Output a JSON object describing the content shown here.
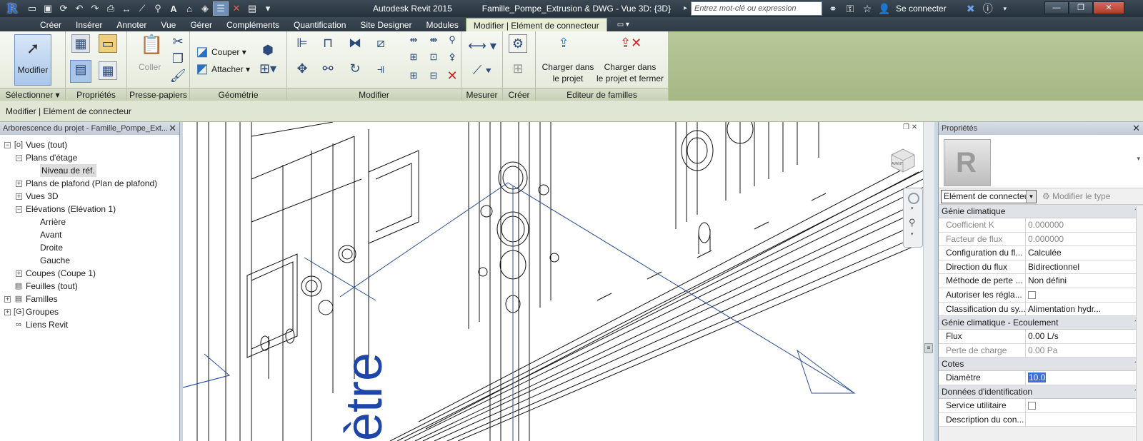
{
  "app": {
    "logo_letter": "R",
    "title": "Autodesk Revit 2015",
    "document": "Famille_Pompe_Extrusion & DWG - Vue 3D: {3D}",
    "search_placeholder": "Entrez mot-clé ou expression",
    "signin": "Se connecter"
  },
  "tabs": [
    "Créer",
    "Insérer",
    "Annoter",
    "Vue",
    "Gérer",
    "Compléments",
    "Quantification",
    "Site Designer",
    "Modules",
    "Modifier | Elément de connecteur"
  ],
  "ribbon": {
    "panels": {
      "select": "Sélectionner",
      "properties": "Propriétés",
      "clipboard": "Presse-papiers",
      "geometry": "Géométrie",
      "modify": "Modifier",
      "measure": "Mesurer",
      "create": "Créer",
      "family_editor": "Editeur de familles"
    },
    "modify_button": "Modifier",
    "paste": "Coller",
    "cut": "Couper",
    "join": "Attacher",
    "load_project_1": "Charger dans",
    "load_project_2": "le projet",
    "load_close_1": "Charger dans",
    "load_close_2": "le projet et fermer"
  },
  "options_bar": "Modifier | Elément de connecteur",
  "browser": {
    "title": "Arborescence du projet - Famille_Pompe_Ext...",
    "nodes": [
      {
        "label": "Vues (tout)",
        "level": 0,
        "pm": "−",
        "icon": "[o]"
      },
      {
        "label": "Plans d'étage",
        "level": 1,
        "pm": "−"
      },
      {
        "label": "Niveau de réf.",
        "level": 2,
        "selected": true
      },
      {
        "label": "Plans de plafond (Plan de plafond)",
        "level": 1,
        "pm": "+"
      },
      {
        "label": "Vues 3D",
        "level": 1,
        "pm": "+"
      },
      {
        "label": "Elévations (Elévation 1)",
        "level": 1,
        "pm": "−"
      },
      {
        "label": "Arrière",
        "level": 2
      },
      {
        "label": "Avant",
        "level": 2
      },
      {
        "label": "Droite",
        "level": 2
      },
      {
        "label": "Gauche",
        "level": 2
      },
      {
        "label": "Coupes (Coupe 1)",
        "level": 1,
        "pm": "+"
      },
      {
        "label": "Feuilles (tout)",
        "level": 0,
        "pm": "",
        "icon": "▤"
      },
      {
        "label": "Familles",
        "level": 0,
        "pm": "+",
        "icon": "▤"
      },
      {
        "label": "Groupes",
        "level": 0,
        "pm": "+",
        "icon": "[G]"
      },
      {
        "label": "Liens Revit",
        "level": 0,
        "pm": "",
        "icon": "∞"
      }
    ]
  },
  "viewport": {
    "label_text": "ètre",
    "viewcube_face": "AVANT"
  },
  "properties": {
    "title": "Propriétés",
    "type_selector": "Elément de connecteur",
    "modify_type": "Modifier le type",
    "groups": [
      {
        "name": "Génie climatique",
        "rows": [
          {
            "k": "Coefficient K",
            "v": "0.000000",
            "dis": true
          },
          {
            "k": "Facteur de flux",
            "v": "0.000000",
            "dis": true
          },
          {
            "k": "Configuration du fl...",
            "v": "Calculée"
          },
          {
            "k": "Direction du flux",
            "v": "Bidirectionnel"
          },
          {
            "k": "Méthode de perte ...",
            "v": "Non défini"
          },
          {
            "k": "Autoriser les régla...",
            "v": "",
            "checkbox": true
          },
          {
            "k": "Classification du sy...",
            "v": "Alimentation hydr..."
          }
        ]
      },
      {
        "name": "Génie climatique - Ecoulement",
        "rows": [
          {
            "k": "Flux",
            "v": "0.00 L/s"
          },
          {
            "k": "Perte de charge",
            "v": "0.00 Pa",
            "dis": true
          }
        ]
      },
      {
        "name": "Cotes",
        "rows": [
          {
            "k": "Diamètre",
            "v": "10.0",
            "highlight": true
          }
        ]
      },
      {
        "name": "Données d'identification",
        "rows": [
          {
            "k": "Service utilitaire",
            "v": "",
            "checkbox": true
          },
          {
            "k": "Description du con...",
            "v": ""
          }
        ]
      }
    ]
  }
}
